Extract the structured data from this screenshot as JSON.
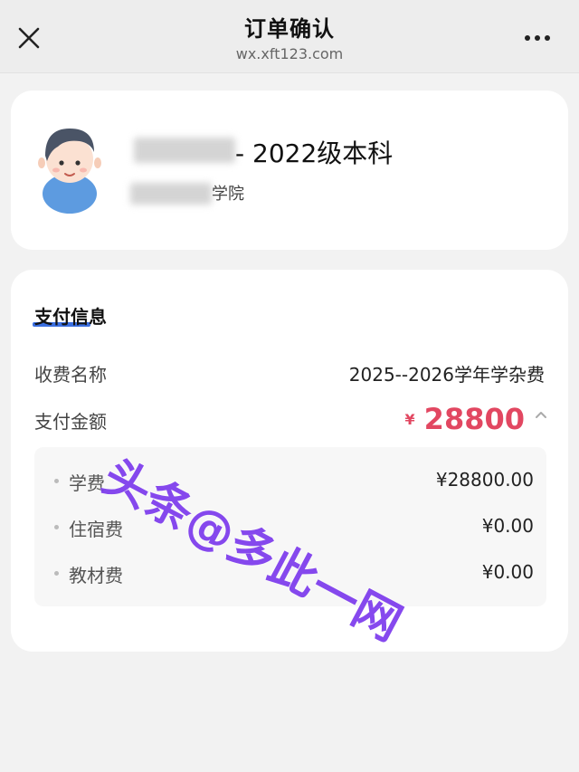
{
  "header": {
    "title": "订单确认",
    "domain": "wx.xft123.com"
  },
  "profile": {
    "title": "- 2022级本科",
    "college": "学院"
  },
  "payment": {
    "section_title": "支付信息",
    "fee_name_label": "收费名称",
    "fee_name_value": "2025--2026学年学杂费",
    "amount_label": "支付金额",
    "currency": "¥",
    "amount": "28800",
    "items": [
      {
        "name": "学费",
        "price": "¥28800.00"
      },
      {
        "name": "住宿费",
        "price": "¥0.00"
      },
      {
        "name": "教材费",
        "price": "¥0.00"
      }
    ]
  },
  "watermark": "头条@多此一网",
  "colors": {
    "accent_red": "#e24761",
    "underline_blue": "#3b6fe0",
    "watermark_purple": "#7c3aed"
  },
  "icons": [
    "close-icon",
    "more-icon",
    "avatar-icon",
    "chevron-up-icon"
  ]
}
